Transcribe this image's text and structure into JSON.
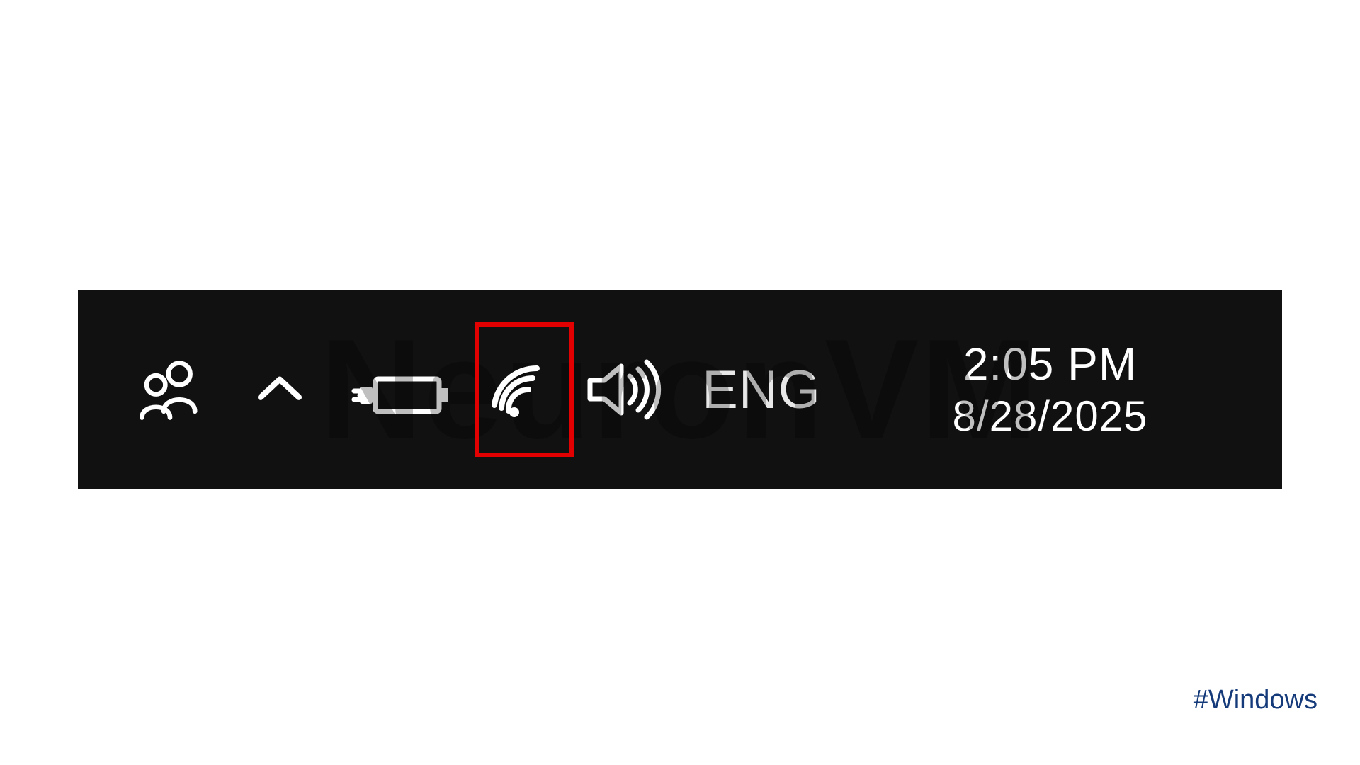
{
  "taskbar": {
    "language": "ENG",
    "time": "2:05 PM",
    "date": "8/28/2025"
  },
  "watermark": "NeuronVM",
  "hashtag": "#Windows",
  "highlight": {
    "target": "wifi-icon"
  }
}
